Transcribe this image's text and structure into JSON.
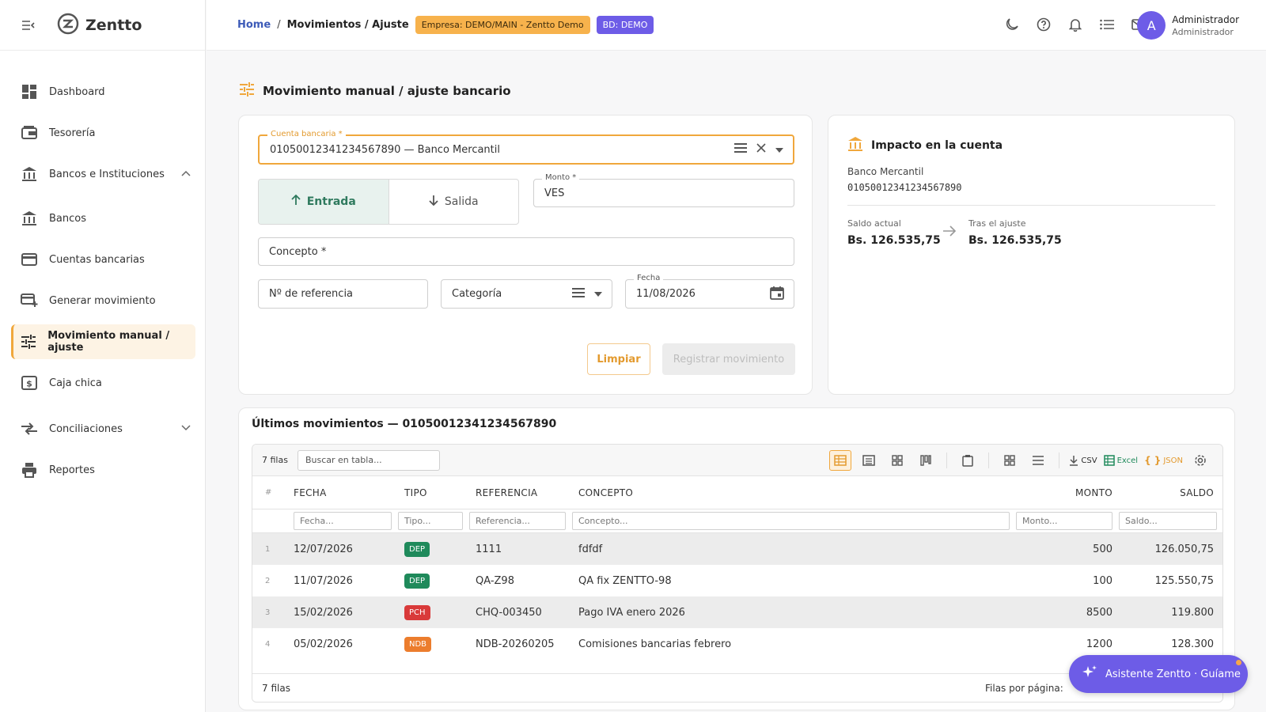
{
  "app": {
    "name": "Zentto"
  },
  "sidebar": {
    "items": [
      {
        "label": "Dashboard"
      },
      {
        "label": "Tesorería"
      },
      {
        "label": "Bancos e Instituciones"
      },
      {
        "label": "Bancos"
      },
      {
        "label": "Cuentas bancarias"
      },
      {
        "label": "Generar movimiento"
      },
      {
        "label": "Movimiento manual / ajuste"
      },
      {
        "label": "Caja chica"
      },
      {
        "label": "Conciliaciones"
      },
      {
        "label": "Reportes"
      }
    ]
  },
  "header": {
    "breadcrumb_home": "Home",
    "breadcrumb_sep": "/",
    "breadcrumb_current": "Movimientos / Ajuste",
    "empresa_chip": "Empresa: DEMO/MAIN - Zentto Demo",
    "bd_chip": "BD: DEMO",
    "user_name": "Administrador",
    "user_role": "Administrador",
    "avatar_letter": "A"
  },
  "page": {
    "title": "Movimiento manual / ajuste bancario"
  },
  "form": {
    "account_label": "Cuenta bancaria *",
    "account_value": "01050012341234567890 — Banco Mercantil",
    "entrada_label": "Entrada",
    "salida_label": "Salida",
    "monto_label": "Monto *",
    "monto_currency": "VES",
    "concepto_label": "Concepto *",
    "referencia_label": "Nº de referencia",
    "categoria_label": "Categoría",
    "fecha_label": "Fecha",
    "fecha_value": "11/08/2026",
    "clear_button": "Limpiar",
    "register_button": "Registrar movimiento"
  },
  "impact": {
    "title": "Impacto en la cuenta",
    "bank": "Banco Mercantil",
    "account": "01050012341234567890",
    "saldo_actual_label": "Saldo actual",
    "saldo_actual_value": "Bs. 126.535,75",
    "tras_label": "Tras el ajuste",
    "tras_value": "Bs. 126.535,75"
  },
  "table": {
    "title": "Últimos movimientos — 01050012341234567890",
    "row_count": "7 filas",
    "search_placeholder": "Buscar en tabla...",
    "csv_label": "CSV",
    "excel_label": "Excel",
    "json_label": "JSON",
    "columns": {
      "num": "#",
      "fecha": "FECHA",
      "tipo": "TIPO",
      "referencia": "REFERENCIA",
      "concepto": "CONCEPTO",
      "monto": "MONTO",
      "saldo": "SALDO"
    },
    "filters": {
      "fecha": "Fecha...",
      "tipo": "Tipo...",
      "referencia": "Referencia...",
      "concepto": "Concepto...",
      "monto": "Monto...",
      "saldo": "Saldo..."
    },
    "rows": [
      {
        "n": "1",
        "fecha": "12/07/2026",
        "tipo": "DEP",
        "ref": "1111",
        "concepto": "fdfdf",
        "monto": "500",
        "saldo": "126.050,75"
      },
      {
        "n": "2",
        "fecha": "11/07/2026",
        "tipo": "DEP",
        "ref": "QA-Z98",
        "concepto": "QA fix ZENTTO-98",
        "monto": "100",
        "saldo": "125.550,75"
      },
      {
        "n": "3",
        "fecha": "15/02/2026",
        "tipo": "PCH",
        "ref": "CHQ-003450",
        "concepto": "Pago IVA enero 2026",
        "monto": "8500",
        "saldo": "119.800"
      },
      {
        "n": "4",
        "fecha": "05/02/2026",
        "tipo": "NDB",
        "ref": "NDB-20260205",
        "concepto": "Comisiones bancarias febrero",
        "monto": "1200",
        "saldo": "128.300"
      }
    ],
    "footer_count": "7 filas",
    "rows_per_page_label": "Filas por página:"
  },
  "assistant": {
    "label": "Asistente Zentto · Guíame"
  },
  "colors": {
    "accent": "#f0a73c",
    "brand_purple": "#6d5ce7",
    "dep": "#1f8a5b",
    "pch": "#d93a3a",
    "ndb": "#ec7d2d",
    "link": "#3d5bb8"
  },
  "icons": [
    "menu-collapse-icon",
    "zentto-logo-icon",
    "dashboard-icon",
    "treasury-icon",
    "bank-icon",
    "credit-card-icon",
    "add-card-icon",
    "tune-icon",
    "cash-icon",
    "compare-arrows-icon",
    "printer-icon",
    "moon-icon",
    "help-icon",
    "bell-icon",
    "list-icon",
    "mail-icon",
    "calendar-icon",
    "sparkle-icon"
  ]
}
